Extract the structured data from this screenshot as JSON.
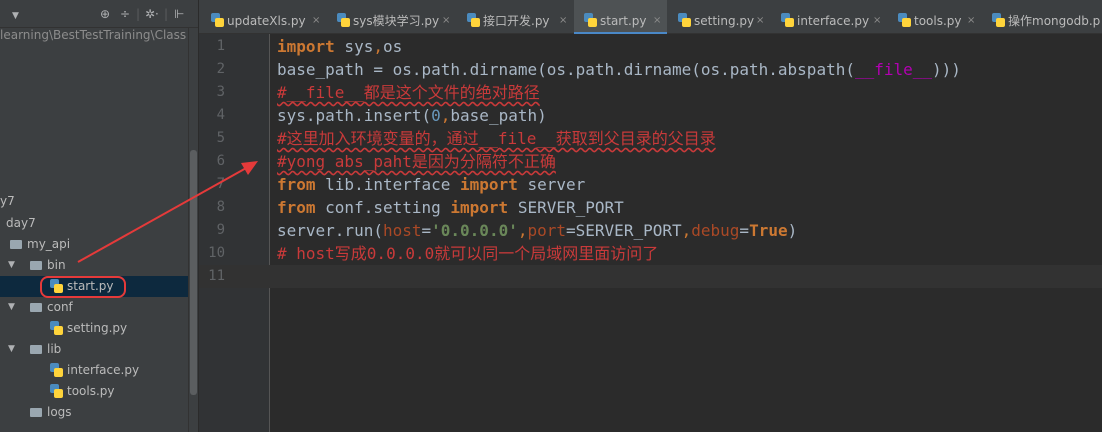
{
  "colors": {
    "panel_bg": "#3c3f41",
    "editor_bg": "#2b2b2b",
    "keyword": "#cc7832",
    "string": "#6a8759",
    "number": "#6897bb",
    "parameter": "#aa4926",
    "comment": "#c93a3a",
    "annotation": "#e53a3a",
    "selection": "#0d293e"
  },
  "project_panel": {
    "toolbar_icons": [
      "dropdown-icon",
      "target-icon",
      "collapse-all-icon",
      "gear-icon",
      "hide-icon"
    ],
    "toolbar_glyphs": {
      "dropdown": "▼",
      "target": "⊕",
      "collapse": "÷",
      "sep": "|",
      "gear": "✲·",
      "hide": "⊩"
    },
    "path": "learning\\BestTestTraining\\Class",
    "tree": {
      "item_y7": "y7",
      "item_day7": "day7",
      "my_api": "my_api",
      "bin": "bin",
      "start": "start.py",
      "conf": "conf",
      "setting": "setting.py",
      "lib": "lib",
      "interface": "interface.py",
      "tools": "tools.py",
      "logs": "logs"
    },
    "expand_arrow": "▼"
  },
  "tabs": [
    {
      "label": "updateXls.py",
      "active": false
    },
    {
      "label": "sys模块学习.py",
      "active": false
    },
    {
      "label": "接口开发.py",
      "active": false
    },
    {
      "label": "start.py",
      "active": true
    },
    {
      "label": "setting.py",
      "active": false
    },
    {
      "label": "interface.py",
      "active": false
    },
    {
      "label": "tools.py",
      "active": false
    },
    {
      "label": "操作mongodb.p",
      "active": false
    }
  ],
  "tab_close_glyph": "×",
  "editor": {
    "current_line": 11,
    "line_numbers": [
      "1",
      "2",
      "3",
      "4",
      "5",
      "6",
      "7",
      "8",
      "9",
      "10",
      "11"
    ],
    "code": {
      "l1": {
        "kw": "import",
        "a": " sys",
        "sep": ",",
        "b": "os"
      },
      "l2": {
        "a": "base_path = os.path.dirname(os.path.dirname(os.path.abspath(",
        "magic": "__file__",
        "b": ")))"
      },
      "l3": "#__file__都是这个文件的绝对路径",
      "l4": {
        "a": "sys.path.insert(",
        "num": "0",
        "sep": ",",
        "b": "base_path)"
      },
      "l5": "#这里加入环境变量的，通过__file__获取到父目录的父目录",
      "l6": "#yong abs_paht是因为分隔符不正确",
      "l7": {
        "kw1": "from",
        "a": " lib.interface ",
        "kw2": "import",
        "b": " server"
      },
      "l8": {
        "kw1": "from",
        "a": " conf.setting ",
        "kw2": "import",
        "b": " SERVER_PORT"
      },
      "l9": {
        "a": "server.run(",
        "p1": "host",
        "eq1": "=",
        "str": "'0.0.0.0'",
        "sep1": ",",
        "p2": "port",
        "b": "=SERVER_PORT",
        "sep2": ",",
        "p3": "debug",
        "eq3": "=",
        "const": "True",
        "c": ")"
      },
      "l10": "# host写成0.0.0.0就可以同一个局域网里面访问了",
      "l11": ""
    }
  }
}
